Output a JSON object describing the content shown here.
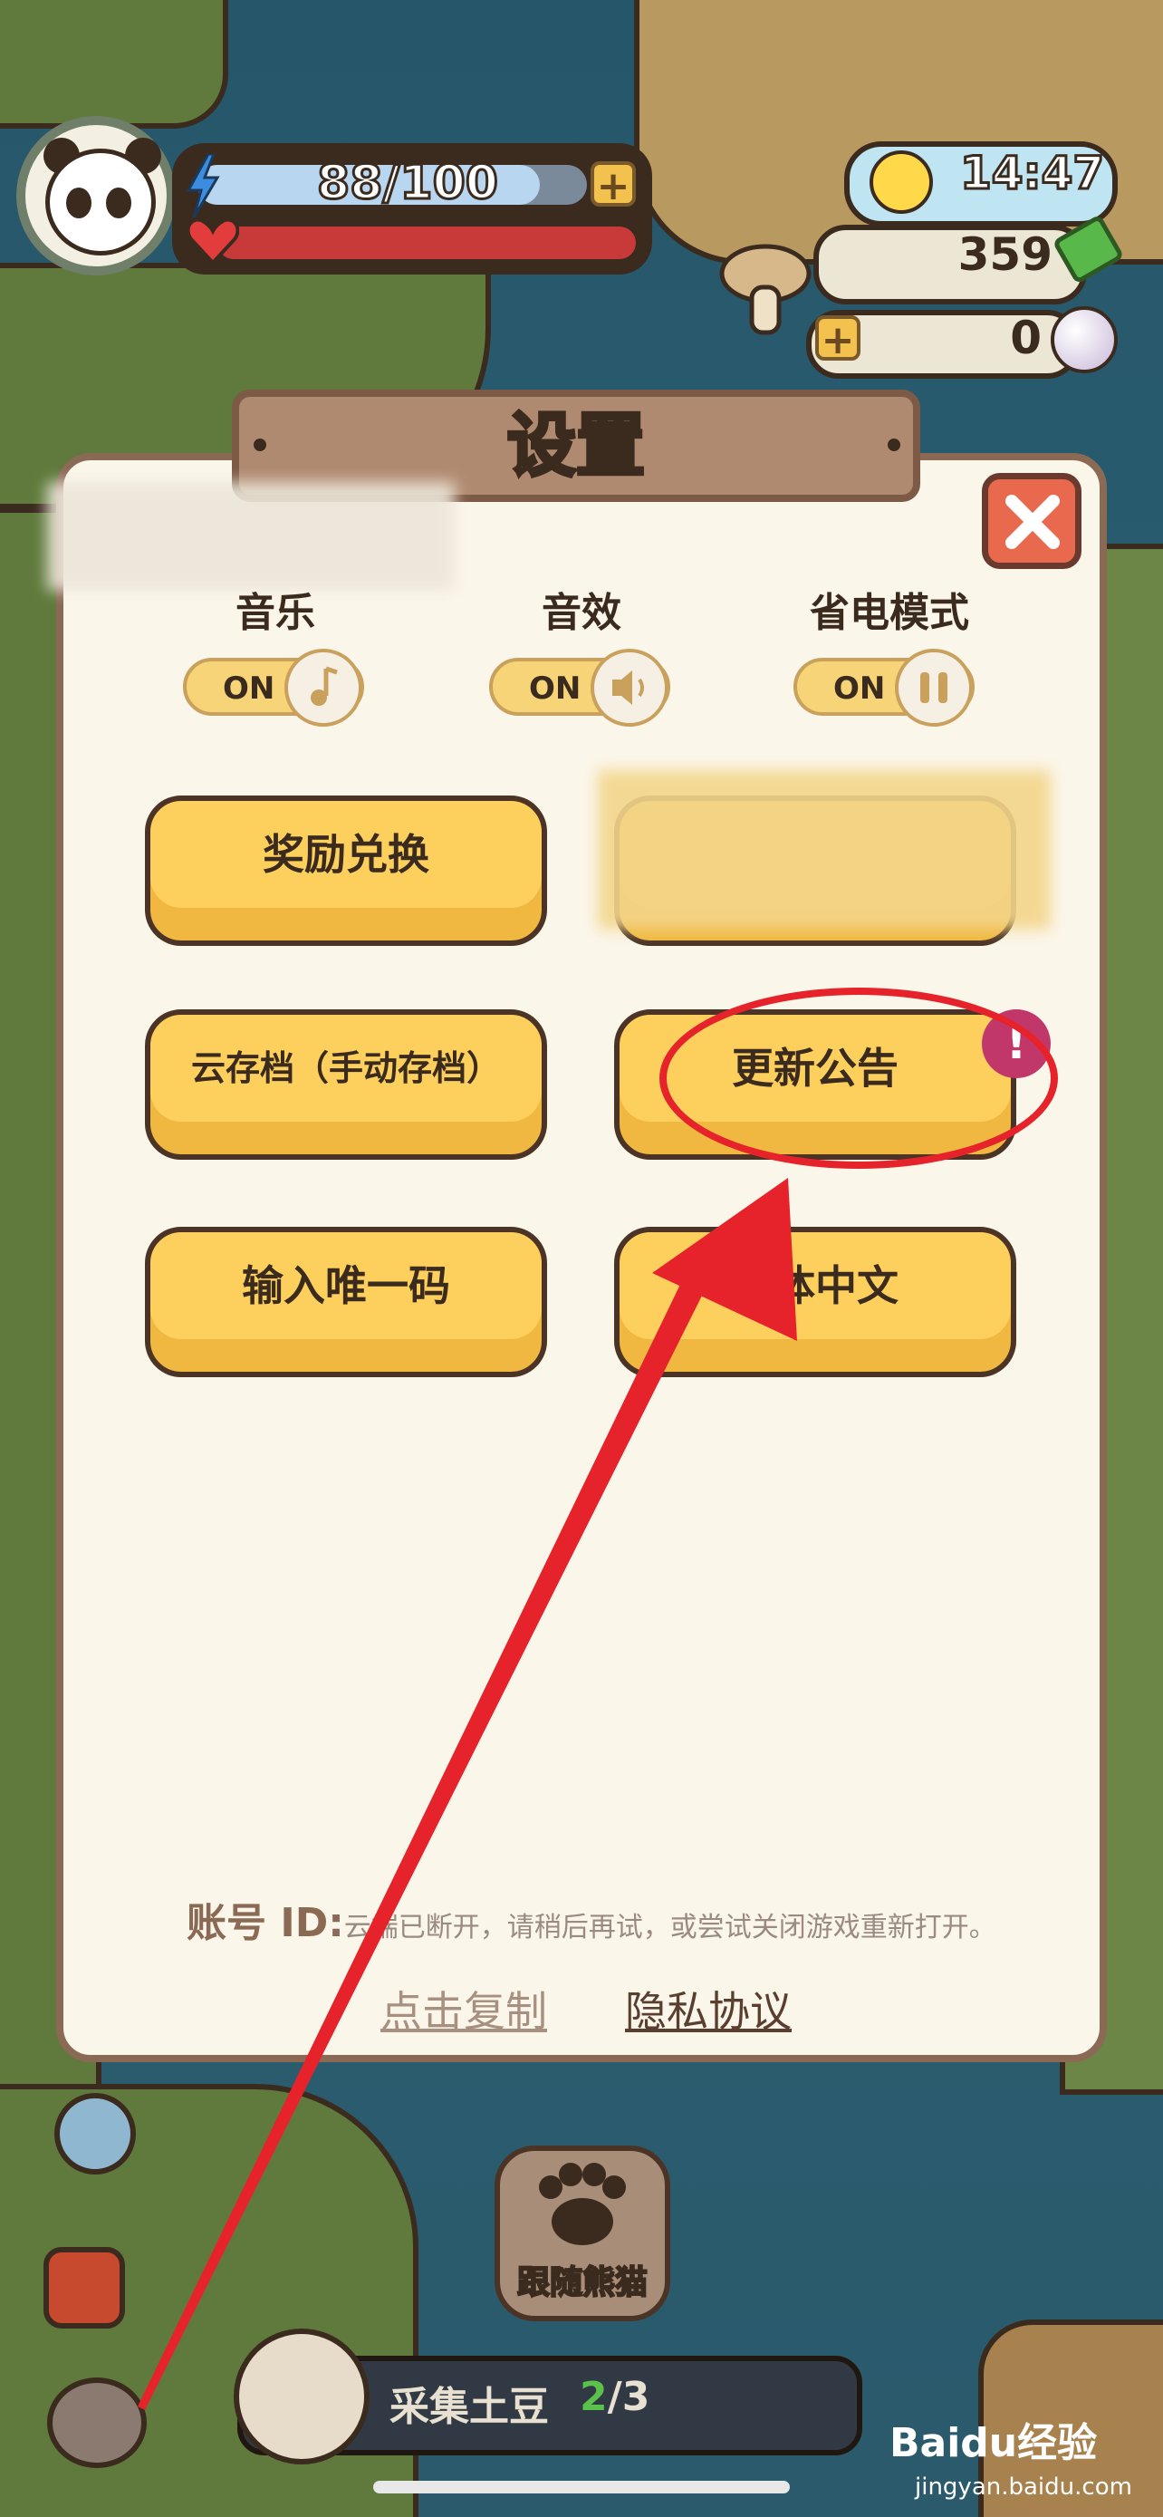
{
  "hud": {
    "energy_text": "88/100",
    "energy_fraction": 0.88,
    "clock": "14:47",
    "mushrooms": "359",
    "pearls": "0",
    "plus_label": "+"
  },
  "dialog": {
    "title": "设置",
    "toggles": [
      {
        "label": "音乐",
        "state": "ON",
        "icon": "music-note-icon"
      },
      {
        "label": "音效",
        "state": "ON",
        "icon": "speaker-icon"
      },
      {
        "label": "省电模式",
        "state": "ON",
        "icon": "pause-icon"
      }
    ],
    "buttons": {
      "reward": "奖励兑换",
      "cloud_save": "云存档（手动存档）",
      "update_notice": "更新公告",
      "unique_code": "输入唯一码",
      "language": "简体中文"
    },
    "update_badge": "!",
    "account_label": "账号 ID:",
    "account_message": "云端已断开，请稍后再试，或尝试关闭游戏重新打开。",
    "copy_link": "点击复制",
    "privacy_link": "隐私协议"
  },
  "bottom": {
    "follow_label": "跟随熊猫",
    "quest_text": "采集土豆",
    "quest_done": "2",
    "quest_total": "/3"
  },
  "watermark": {
    "brand": "Baidu经验",
    "url": "jingyan.baidu.com"
  },
  "colors": {
    "dialog_bg": "#fbf6ea",
    "button_yellow": "#fdcf5c",
    "annotation_red": "#e6232b",
    "badge": "#c2376a"
  }
}
